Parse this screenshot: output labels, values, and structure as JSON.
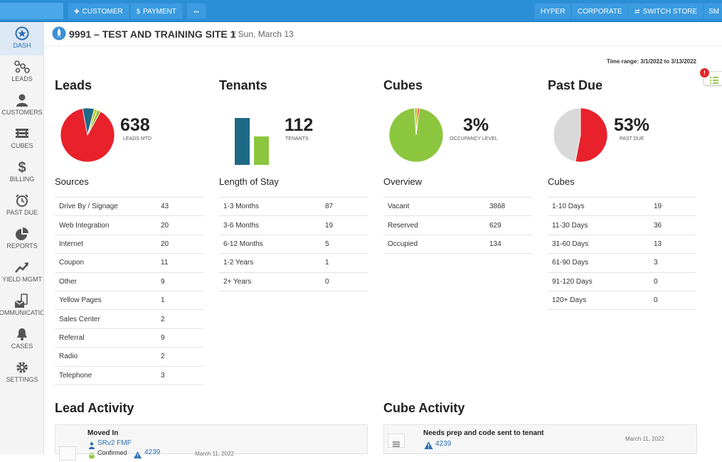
{
  "topbar": {
    "customer_label": "CUSTOMER",
    "payment_label": "PAYMENT",
    "more_label": "•••",
    "hyper_label": "HYPER",
    "corporate_label": "CORPORATE",
    "switch_store_label": "SWITCH STORE",
    "user_initials": "SM",
    "accent": "#2b8fd6"
  },
  "sidebar": {
    "items": [
      {
        "label": "DASH",
        "icon": "star-icon"
      },
      {
        "label": "LEADS",
        "icon": "network-icon"
      },
      {
        "label": "CUSTOMERS",
        "icon": "person-icon"
      },
      {
        "label": "CUBES",
        "icon": "cubes-icon"
      },
      {
        "label": "BILLING",
        "icon": "dollar-icon"
      },
      {
        "label": "PAST DUE",
        "icon": "alarm-icon"
      },
      {
        "label": "REPORTS",
        "icon": "pie-icon"
      },
      {
        "label": "YIELD MGMT",
        "icon": "trend-icon"
      },
      {
        "label": "COMMUNICATION",
        "icon": "mail-phone-icon"
      },
      {
        "label": "CASES",
        "icon": "bell-icon"
      },
      {
        "label": "SETTINGS",
        "icon": "gear-icon"
      }
    ]
  },
  "header": {
    "title": "9991 – TEST AND TRAINING SITE 1",
    "date": "/ Sun, March 13",
    "time_range": "Time range: 3/1/2022 to 3/13/2022",
    "notification_count": "!"
  },
  "leads": {
    "title": "Leads",
    "big_number": "638",
    "big_label": "LEADS MTD",
    "section_title": "Sources",
    "rows": [
      {
        "name": "Drive By / Signage",
        "value": "43"
      },
      {
        "name": "Web Integration",
        "value": "20"
      },
      {
        "name": "Internet",
        "value": "20"
      },
      {
        "name": "Coupon",
        "value": "11"
      },
      {
        "name": "Other",
        "value": "9"
      },
      {
        "name": "Yellow Pages",
        "value": "1"
      },
      {
        "name": "Sales Center",
        "value": "2"
      },
      {
        "name": "Referral",
        "value": "9"
      },
      {
        "name": "Radio",
        "value": "2"
      },
      {
        "name": "Telephone",
        "value": "3"
      }
    ]
  },
  "tenants": {
    "title": "Tenants",
    "big_number": "112",
    "big_label": "TENANTS",
    "section_title": "Length of Stay",
    "rows": [
      {
        "name": "1-3 Months",
        "value": "87"
      },
      {
        "name": "3-6 Months",
        "value": "19"
      },
      {
        "name": "6-12 Months",
        "value": "5"
      },
      {
        "name": "1-2 Years",
        "value": "1"
      },
      {
        "name": "2+ Years",
        "value": "0"
      }
    ]
  },
  "cubes": {
    "title": "Cubes",
    "big_number": "3%",
    "big_label": "OCCUPANCY LEVEL",
    "section_title": "Overview",
    "rows": [
      {
        "name": "Vacant",
        "value": "3868"
      },
      {
        "name": "Reserved",
        "value": "629"
      },
      {
        "name": "Occupied",
        "value": "134"
      }
    ]
  },
  "past_due": {
    "title": "Past Due",
    "big_number": "53%",
    "big_label": "PAST DUE",
    "section_title": "Cubes",
    "rows": [
      {
        "name": "1-10 Days",
        "value": "19"
      },
      {
        "name": "11-30 Days",
        "value": "36"
      },
      {
        "name": "31-60 Days",
        "value": "13"
      },
      {
        "name": "61-90 Days",
        "value": "3"
      },
      {
        "name": "91-120 Days",
        "value": "0"
      },
      {
        "name": "120+ Days",
        "value": "0"
      }
    ]
  },
  "chart_data": [
    {
      "type": "pie",
      "slices": [
        {
          "value": 0.89,
          "color": "#e8212b"
        },
        {
          "value": 0.07,
          "color": "#1e6a86"
        },
        {
          "value": 0.02,
          "color": "#c8c83a"
        },
        {
          "value": 0.02,
          "color": "#8cc63f"
        }
      ]
    },
    {
      "type": "bar",
      "categories": [
        "",
        ""
      ],
      "values": [
        112,
        68
      ],
      "colors": [
        "#1e6a86",
        "#8cc63f"
      ]
    },
    {
      "type": "pie",
      "slices": [
        {
          "value": 0.97,
          "color": "#8cc63f"
        },
        {
          "value": 0.02,
          "color": "#c8c83a"
        },
        {
          "value": 0.01,
          "color": "#e8212b"
        }
      ]
    },
    {
      "type": "pie",
      "slices": [
        {
          "value": 0.53,
          "color": "#e8212b"
        },
        {
          "value": 0.47,
          "color": "#d9d9d9"
        }
      ]
    }
  ],
  "lead_activity": {
    "title": "Lead Activity",
    "item_title": "Moved In",
    "item_person": "SRv2 FMF",
    "item_status": "Confirmed",
    "item_number": "4239",
    "item_date": "March 11, 2022"
  },
  "cube_activity": {
    "title": "Cube Activity",
    "item_title": "Needs prep and code sent to tenant",
    "item_number": "4239",
    "item_date": "March 11, 2022"
  }
}
